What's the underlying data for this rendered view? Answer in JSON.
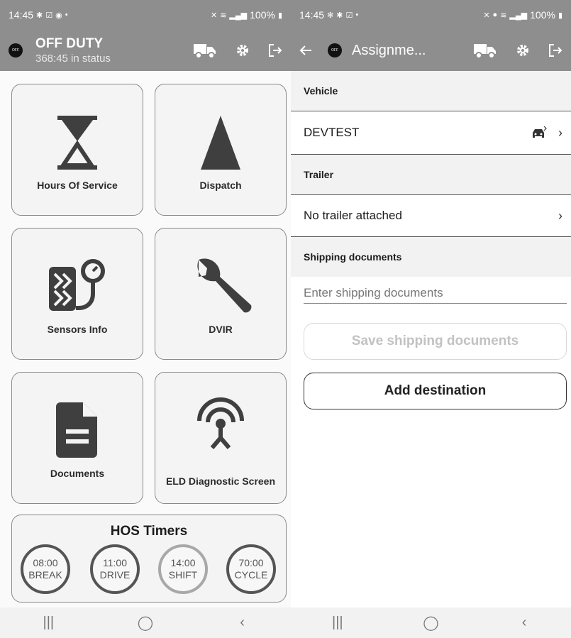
{
  "left": {
    "statusbar": {
      "time": "14:45",
      "battery": "100%"
    },
    "appbar": {
      "status_abbr": "OFF",
      "duty_title": "OFF DUTY",
      "duty_sub": "368:45 in status"
    },
    "tiles": [
      {
        "label": "Hours Of Service",
        "icon": "hourglass-icon"
      },
      {
        "label": "Dispatch",
        "icon": "navigation-arrow-icon"
      },
      {
        "label": "Sensors Info",
        "icon": "tire-gauge-icon"
      },
      {
        "label": "DVIR",
        "icon": "wrench-icon"
      },
      {
        "label": "Documents",
        "icon": "document-icon"
      },
      {
        "label": "ELD Diagnostic Screen",
        "icon": "antenna-icon"
      }
    ],
    "hos": {
      "title": "HOS Timers",
      "timers": [
        {
          "time": "08:00",
          "label": "BREAK"
        },
        {
          "time": "11:00",
          "label": "DRIVE"
        },
        {
          "time": "14:00",
          "label": "SHIFT"
        },
        {
          "time": "70:00",
          "label": "CYCLE"
        }
      ]
    }
  },
  "right": {
    "statusbar": {
      "time": "14:45",
      "battery": "100%"
    },
    "appbar": {
      "status_abbr": "OFF",
      "title": "Assignme..."
    },
    "vehicle_header": "Vehicle",
    "vehicle_name": "DEVTEST",
    "trailer_header": "Trailer",
    "trailer_value": "No trailer attached",
    "shipping_header": "Shipping documents",
    "shipping_placeholder": "Enter shipping documents",
    "save_button": "Save shipping documents",
    "add_destination_button": "Add destination"
  },
  "colors": {
    "appbar": "#8e8e8e",
    "tile_bg": "#f4f4f4",
    "disabled_text": "#c2c2c2"
  }
}
